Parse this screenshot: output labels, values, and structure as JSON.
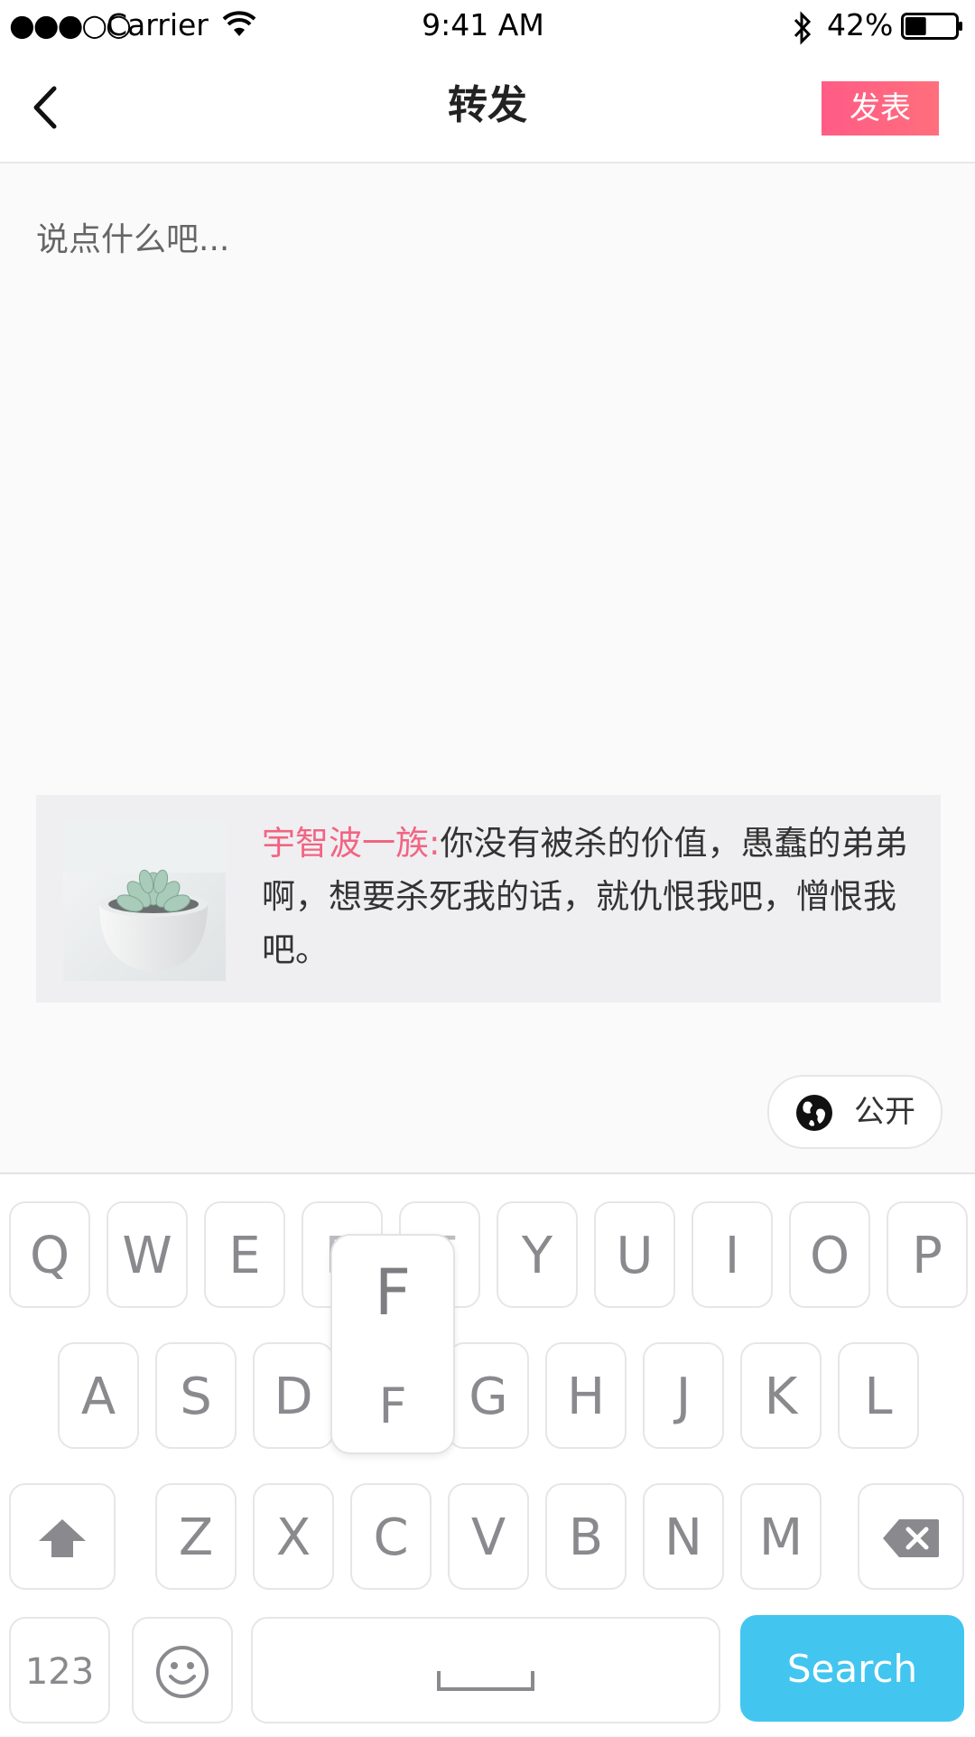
{
  "status_bar": {
    "signal": "●●●○○",
    "carrier": "Carrier",
    "time": "9:41 AM",
    "battery_percent": "42%",
    "battery_level": 0.42
  },
  "nav": {
    "title": "转发",
    "publish_label": "发表"
  },
  "compose": {
    "placeholder": "说点什么吧...",
    "value": ""
  },
  "quote": {
    "author": "宇智波一族:",
    "text": "你没有被杀的价值，愚蠢的弟弟啊，想要杀死我的话，就仇恨我吧，憎恨我吧。"
  },
  "visibility": {
    "label": "公开"
  },
  "keyboard": {
    "row1": [
      "Q",
      "W",
      "E",
      "R",
      "T",
      "Y",
      "U",
      "I",
      "O",
      "P"
    ],
    "row2": [
      "A",
      "S",
      "D",
      "F",
      "G",
      "H",
      "J",
      "K",
      "L"
    ],
    "row3": [
      "Z",
      "X",
      "C",
      "V",
      "B",
      "N",
      "M"
    ],
    "numbers_label": "123",
    "search_label": "Search",
    "pressed_key": "F"
  },
  "colors": {
    "accent_pink": "#ff5b86",
    "author_pink": "#f26482",
    "search_blue": "#42c6f0"
  }
}
